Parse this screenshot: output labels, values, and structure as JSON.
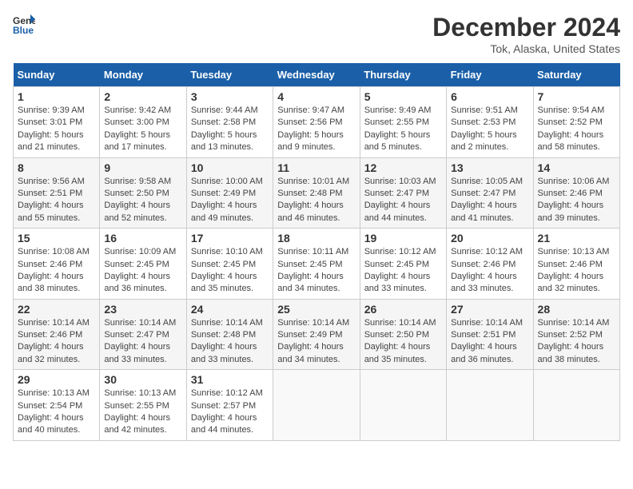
{
  "header": {
    "logo_line1": "General",
    "logo_line2": "Blue",
    "title": "December 2024",
    "subtitle": "Tok, Alaska, United States"
  },
  "days_of_week": [
    "Sunday",
    "Monday",
    "Tuesday",
    "Wednesday",
    "Thursday",
    "Friday",
    "Saturday"
  ],
  "weeks": [
    [
      {
        "day": "1",
        "sunrise": "Sunrise: 9:39 AM",
        "sunset": "Sunset: 3:01 PM",
        "daylight": "Daylight: 5 hours and 21 minutes."
      },
      {
        "day": "2",
        "sunrise": "Sunrise: 9:42 AM",
        "sunset": "Sunset: 3:00 PM",
        "daylight": "Daylight: 5 hours and 17 minutes."
      },
      {
        "day": "3",
        "sunrise": "Sunrise: 9:44 AM",
        "sunset": "Sunset: 2:58 PM",
        "daylight": "Daylight: 5 hours and 13 minutes."
      },
      {
        "day": "4",
        "sunrise": "Sunrise: 9:47 AM",
        "sunset": "Sunset: 2:56 PM",
        "daylight": "Daylight: 5 hours and 9 minutes."
      },
      {
        "day": "5",
        "sunrise": "Sunrise: 9:49 AM",
        "sunset": "Sunset: 2:55 PM",
        "daylight": "Daylight: 5 hours and 5 minutes."
      },
      {
        "day": "6",
        "sunrise": "Sunrise: 9:51 AM",
        "sunset": "Sunset: 2:53 PM",
        "daylight": "Daylight: 5 hours and 2 minutes."
      },
      {
        "day": "7",
        "sunrise": "Sunrise: 9:54 AM",
        "sunset": "Sunset: 2:52 PM",
        "daylight": "Daylight: 4 hours and 58 minutes."
      }
    ],
    [
      {
        "day": "8",
        "sunrise": "Sunrise: 9:56 AM",
        "sunset": "Sunset: 2:51 PM",
        "daylight": "Daylight: 4 hours and 55 minutes."
      },
      {
        "day": "9",
        "sunrise": "Sunrise: 9:58 AM",
        "sunset": "Sunset: 2:50 PM",
        "daylight": "Daylight: 4 hours and 52 minutes."
      },
      {
        "day": "10",
        "sunrise": "Sunrise: 10:00 AM",
        "sunset": "Sunset: 2:49 PM",
        "daylight": "Daylight: 4 hours and 49 minutes."
      },
      {
        "day": "11",
        "sunrise": "Sunrise: 10:01 AM",
        "sunset": "Sunset: 2:48 PM",
        "daylight": "Daylight: 4 hours and 46 minutes."
      },
      {
        "day": "12",
        "sunrise": "Sunrise: 10:03 AM",
        "sunset": "Sunset: 2:47 PM",
        "daylight": "Daylight: 4 hours and 44 minutes."
      },
      {
        "day": "13",
        "sunrise": "Sunrise: 10:05 AM",
        "sunset": "Sunset: 2:47 PM",
        "daylight": "Daylight: 4 hours and 41 minutes."
      },
      {
        "day": "14",
        "sunrise": "Sunrise: 10:06 AM",
        "sunset": "Sunset: 2:46 PM",
        "daylight": "Daylight: 4 hours and 39 minutes."
      }
    ],
    [
      {
        "day": "15",
        "sunrise": "Sunrise: 10:08 AM",
        "sunset": "Sunset: 2:46 PM",
        "daylight": "Daylight: 4 hours and 38 minutes."
      },
      {
        "day": "16",
        "sunrise": "Sunrise: 10:09 AM",
        "sunset": "Sunset: 2:45 PM",
        "daylight": "Daylight: 4 hours and 36 minutes."
      },
      {
        "day": "17",
        "sunrise": "Sunrise: 10:10 AM",
        "sunset": "Sunset: 2:45 PM",
        "daylight": "Daylight: 4 hours and 35 minutes."
      },
      {
        "day": "18",
        "sunrise": "Sunrise: 10:11 AM",
        "sunset": "Sunset: 2:45 PM",
        "daylight": "Daylight: 4 hours and 34 minutes."
      },
      {
        "day": "19",
        "sunrise": "Sunrise: 10:12 AM",
        "sunset": "Sunset: 2:45 PM",
        "daylight": "Daylight: 4 hours and 33 minutes."
      },
      {
        "day": "20",
        "sunrise": "Sunrise: 10:12 AM",
        "sunset": "Sunset: 2:46 PM",
        "daylight": "Daylight: 4 hours and 33 minutes."
      },
      {
        "day": "21",
        "sunrise": "Sunrise: 10:13 AM",
        "sunset": "Sunset: 2:46 PM",
        "daylight": "Daylight: 4 hours and 32 minutes."
      }
    ],
    [
      {
        "day": "22",
        "sunrise": "Sunrise: 10:14 AM",
        "sunset": "Sunset: 2:46 PM",
        "daylight": "Daylight: 4 hours and 32 minutes."
      },
      {
        "day": "23",
        "sunrise": "Sunrise: 10:14 AM",
        "sunset": "Sunset: 2:47 PM",
        "daylight": "Daylight: 4 hours and 33 minutes."
      },
      {
        "day": "24",
        "sunrise": "Sunrise: 10:14 AM",
        "sunset": "Sunset: 2:48 PM",
        "daylight": "Daylight: 4 hours and 33 minutes."
      },
      {
        "day": "25",
        "sunrise": "Sunrise: 10:14 AM",
        "sunset": "Sunset: 2:49 PM",
        "daylight": "Daylight: 4 hours and 34 minutes."
      },
      {
        "day": "26",
        "sunrise": "Sunrise: 10:14 AM",
        "sunset": "Sunset: 2:50 PM",
        "daylight": "Daylight: 4 hours and 35 minutes."
      },
      {
        "day": "27",
        "sunrise": "Sunrise: 10:14 AM",
        "sunset": "Sunset: 2:51 PM",
        "daylight": "Daylight: 4 hours and 36 minutes."
      },
      {
        "day": "28",
        "sunrise": "Sunrise: 10:14 AM",
        "sunset": "Sunset: 2:52 PM",
        "daylight": "Daylight: 4 hours and 38 minutes."
      }
    ],
    [
      {
        "day": "29",
        "sunrise": "Sunrise: 10:13 AM",
        "sunset": "Sunset: 2:54 PM",
        "daylight": "Daylight: 4 hours and 40 minutes."
      },
      {
        "day": "30",
        "sunrise": "Sunrise: 10:13 AM",
        "sunset": "Sunset: 2:55 PM",
        "daylight": "Daylight: 4 hours and 42 minutes."
      },
      {
        "day": "31",
        "sunrise": "Sunrise: 10:12 AM",
        "sunset": "Sunset: 2:57 PM",
        "daylight": "Daylight: 4 hours and 44 minutes."
      },
      null,
      null,
      null,
      null
    ]
  ]
}
